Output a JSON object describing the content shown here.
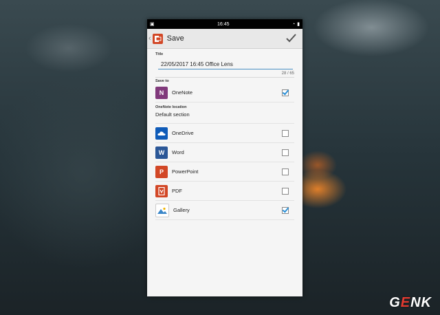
{
  "status_bar": {
    "time": "16:45"
  },
  "app_bar": {
    "title": "Save"
  },
  "title_section": {
    "label": "Title",
    "value": "22/05/2017 16:45 Office Lens",
    "counter": "28 / 65"
  },
  "save_to": {
    "label": "Save to",
    "onenote": {
      "label": "OneNote",
      "checked": true
    },
    "location_label": "OneNote location",
    "location_value": "Default section",
    "targets": [
      {
        "label": "OneDrive",
        "checked": false,
        "color": "#0f5bb8"
      },
      {
        "label": "Word",
        "checked": false,
        "color": "#2b5797"
      },
      {
        "label": "PowerPoint",
        "checked": false,
        "color": "#d24726"
      },
      {
        "label": "PDF",
        "checked": false,
        "color": "#d24726"
      },
      {
        "label": "Gallery",
        "checked": true,
        "color": "#ffffff"
      }
    ]
  },
  "watermark": {
    "logo_text": "GENK"
  },
  "colors": {
    "accent": "#2a8fd6",
    "onenote": "#80397b",
    "office": "#d24726"
  }
}
